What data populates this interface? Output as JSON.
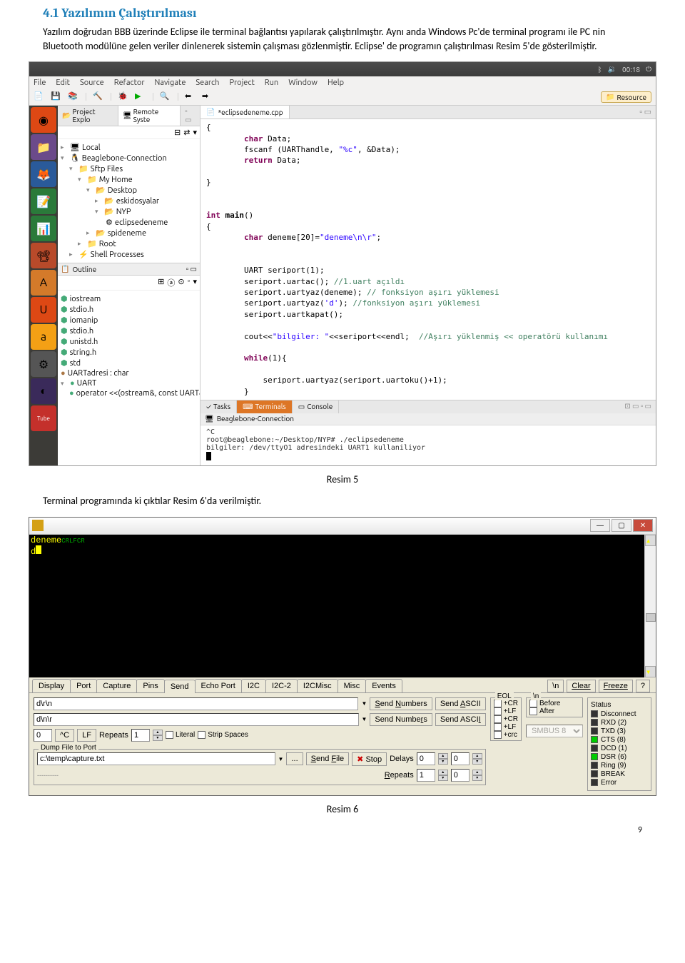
{
  "doc": {
    "heading": "4.1 Yazılımın Çalıştırılması",
    "para1": "Yazılım doğrudan BBB üzerinde Eclipse ile terminal bağlantısı yapılarak çalıştırılmıştır. Aynı anda Windows Pc'de terminal programı ile PC nin Bluetooth modülüne gelen veriler dinlenerek sistemin çalışması gözlenmiştir. Eclipse' de programın çalıştırılması Resim 5'de gösterilmiştir.",
    "caption1": "Resim 5",
    "para2": "Terminal programında ki çıktılar Resim 6'da verilmiştir.",
    "caption2": "Resim 6",
    "pagenum": "9"
  },
  "eclipse": {
    "topbar": {
      "time": "00:18",
      "bt": "⚪",
      "sound": "🔊"
    },
    "menu": [
      "File",
      "Edit",
      "Source",
      "Refactor",
      "Navigate",
      "Search",
      "Project",
      "Run",
      "Window",
      "Help"
    ],
    "resourceBtn": "Resource",
    "leftTabs": {
      "explorer": "Project Explo",
      "remote": "Remote Syste"
    },
    "tree": {
      "local": "Local",
      "conn": "Beaglebone-Connection",
      "sftp": "Sftp Files",
      "myhome": "My Home",
      "desktop": "Desktop",
      "eskidosyalar": "eskidosyalar",
      "nyp": "NYP",
      "eclipsedeneme": "eclipsedeneme",
      "spideneme": "spideneme",
      "root": "Root",
      "shell": "Shell Processes"
    },
    "outlineHdr": "Outline",
    "outline": [
      "iostream",
      "stdio.h",
      "iomanip",
      "stdio.h",
      "unistd.h",
      "string.h",
      "std",
      "UARTadresi : char",
      "UART",
      "operator <<(ostream&, const UART&) : o"
    ],
    "editorTab": "*eclipsedeneme.cpp",
    "bottomTabs": {
      "tasks": "Tasks",
      "terminals": "Terminals",
      "console": "Console"
    },
    "termHeader": "Beaglebone-Connection",
    "termLines": [
      "^C",
      "root@beaglebone:~/Desktop/NYP# ./eclipsedeneme",
      "bilgiler: /dev/ttyO1 adresindeki UART1 kullaniliyor"
    ]
  },
  "realterm": {
    "termLines": [
      {
        "text": "deneme",
        "suffix": "CRLFCR"
      },
      {
        "text": "d",
        "suffix": ""
      }
    ],
    "tabs": [
      "Display",
      "Port",
      "Capture",
      "Pins",
      "Send",
      "Echo Port",
      "I2C",
      "I2C-2",
      "I2CMisc",
      "Misc",
      "Events"
    ],
    "activeTab": "Send",
    "rightBtns": {
      "newline": "\\n",
      "clear": "Clear",
      "freeze": "Freeze",
      "help": "?"
    },
    "send": {
      "line1": "d\\r\\n",
      "line2": "d\\n\\r",
      "sendNumbers": "Send Numbers",
      "sendAscii": "Send ASCII",
      "eolTitle": "EOL",
      "eolOpts": [
        "+CR",
        "+LF",
        "+CR",
        "+LF",
        "+crc"
      ],
      "carretC": "^C",
      "lf": "LF",
      "zero": "0",
      "repeats": "Repeats",
      "repeatsVal": "1",
      "literal": "Literal",
      "stripSpaces": "Strip Spaces",
      "dumpTitle": "Dump File to Port",
      "dumpPath": "c:\\temp\\capture.txt",
      "dots": "...",
      "sendFile": "Send File",
      "stop": "Stop",
      "delays": "Delays",
      "delaysVal1": "0",
      "delaysVal2": "0",
      "repeats2": "Repeats",
      "repeats2Val": "1",
      "repeats2Val2": "0",
      "nlGroup": "\\n",
      "before": "Before",
      "after": "After",
      "smbus": "SMBUS 8"
    },
    "status": {
      "title": "Status",
      "items": [
        {
          "label": "Disconnect",
          "on": false
        },
        {
          "label": "RXD (2)",
          "on": false
        },
        {
          "label": "TXD (3)",
          "on": false
        },
        {
          "label": "CTS (8)",
          "on": true
        },
        {
          "label": "DCD (1)",
          "on": false
        },
        {
          "label": "DSR (6)",
          "on": true
        },
        {
          "label": "Ring (9)",
          "on": false
        },
        {
          "label": "BREAK",
          "on": false
        },
        {
          "label": "Error",
          "on": false
        }
      ]
    }
  }
}
